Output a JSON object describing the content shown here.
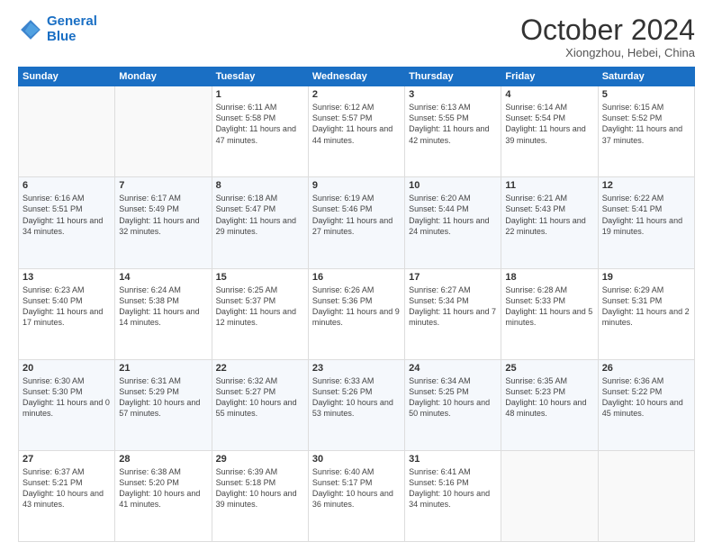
{
  "logo": {
    "line1": "General",
    "line2": "Blue"
  },
  "header": {
    "month": "October 2024",
    "location": "Xiongzhou, Hebei, China"
  },
  "weekdays": [
    "Sunday",
    "Monday",
    "Tuesday",
    "Wednesday",
    "Thursday",
    "Friday",
    "Saturday"
  ],
  "weeks": [
    [
      {
        "day": "",
        "text": ""
      },
      {
        "day": "",
        "text": ""
      },
      {
        "day": "1",
        "text": "Sunrise: 6:11 AM\nSunset: 5:58 PM\nDaylight: 11 hours and 47 minutes."
      },
      {
        "day": "2",
        "text": "Sunrise: 6:12 AM\nSunset: 5:57 PM\nDaylight: 11 hours and 44 minutes."
      },
      {
        "day": "3",
        "text": "Sunrise: 6:13 AM\nSunset: 5:55 PM\nDaylight: 11 hours and 42 minutes."
      },
      {
        "day": "4",
        "text": "Sunrise: 6:14 AM\nSunset: 5:54 PM\nDaylight: 11 hours and 39 minutes."
      },
      {
        "day": "5",
        "text": "Sunrise: 6:15 AM\nSunset: 5:52 PM\nDaylight: 11 hours and 37 minutes."
      }
    ],
    [
      {
        "day": "6",
        "text": "Sunrise: 6:16 AM\nSunset: 5:51 PM\nDaylight: 11 hours and 34 minutes."
      },
      {
        "day": "7",
        "text": "Sunrise: 6:17 AM\nSunset: 5:49 PM\nDaylight: 11 hours and 32 minutes."
      },
      {
        "day": "8",
        "text": "Sunrise: 6:18 AM\nSunset: 5:47 PM\nDaylight: 11 hours and 29 minutes."
      },
      {
        "day": "9",
        "text": "Sunrise: 6:19 AM\nSunset: 5:46 PM\nDaylight: 11 hours and 27 minutes."
      },
      {
        "day": "10",
        "text": "Sunrise: 6:20 AM\nSunset: 5:44 PM\nDaylight: 11 hours and 24 minutes."
      },
      {
        "day": "11",
        "text": "Sunrise: 6:21 AM\nSunset: 5:43 PM\nDaylight: 11 hours and 22 minutes."
      },
      {
        "day": "12",
        "text": "Sunrise: 6:22 AM\nSunset: 5:41 PM\nDaylight: 11 hours and 19 minutes."
      }
    ],
    [
      {
        "day": "13",
        "text": "Sunrise: 6:23 AM\nSunset: 5:40 PM\nDaylight: 11 hours and 17 minutes."
      },
      {
        "day": "14",
        "text": "Sunrise: 6:24 AM\nSunset: 5:38 PM\nDaylight: 11 hours and 14 minutes."
      },
      {
        "day": "15",
        "text": "Sunrise: 6:25 AM\nSunset: 5:37 PM\nDaylight: 11 hours and 12 minutes."
      },
      {
        "day": "16",
        "text": "Sunrise: 6:26 AM\nSunset: 5:36 PM\nDaylight: 11 hours and 9 minutes."
      },
      {
        "day": "17",
        "text": "Sunrise: 6:27 AM\nSunset: 5:34 PM\nDaylight: 11 hours and 7 minutes."
      },
      {
        "day": "18",
        "text": "Sunrise: 6:28 AM\nSunset: 5:33 PM\nDaylight: 11 hours and 5 minutes."
      },
      {
        "day": "19",
        "text": "Sunrise: 6:29 AM\nSunset: 5:31 PM\nDaylight: 11 hours and 2 minutes."
      }
    ],
    [
      {
        "day": "20",
        "text": "Sunrise: 6:30 AM\nSunset: 5:30 PM\nDaylight: 11 hours and 0 minutes."
      },
      {
        "day": "21",
        "text": "Sunrise: 6:31 AM\nSunset: 5:29 PM\nDaylight: 10 hours and 57 minutes."
      },
      {
        "day": "22",
        "text": "Sunrise: 6:32 AM\nSunset: 5:27 PM\nDaylight: 10 hours and 55 minutes."
      },
      {
        "day": "23",
        "text": "Sunrise: 6:33 AM\nSunset: 5:26 PM\nDaylight: 10 hours and 53 minutes."
      },
      {
        "day": "24",
        "text": "Sunrise: 6:34 AM\nSunset: 5:25 PM\nDaylight: 10 hours and 50 minutes."
      },
      {
        "day": "25",
        "text": "Sunrise: 6:35 AM\nSunset: 5:23 PM\nDaylight: 10 hours and 48 minutes."
      },
      {
        "day": "26",
        "text": "Sunrise: 6:36 AM\nSunset: 5:22 PM\nDaylight: 10 hours and 45 minutes."
      }
    ],
    [
      {
        "day": "27",
        "text": "Sunrise: 6:37 AM\nSunset: 5:21 PM\nDaylight: 10 hours and 43 minutes."
      },
      {
        "day": "28",
        "text": "Sunrise: 6:38 AM\nSunset: 5:20 PM\nDaylight: 10 hours and 41 minutes."
      },
      {
        "day": "29",
        "text": "Sunrise: 6:39 AM\nSunset: 5:18 PM\nDaylight: 10 hours and 39 minutes."
      },
      {
        "day": "30",
        "text": "Sunrise: 6:40 AM\nSunset: 5:17 PM\nDaylight: 10 hours and 36 minutes."
      },
      {
        "day": "31",
        "text": "Sunrise: 6:41 AM\nSunset: 5:16 PM\nDaylight: 10 hours and 34 minutes."
      },
      {
        "day": "",
        "text": ""
      },
      {
        "day": "",
        "text": ""
      }
    ]
  ]
}
